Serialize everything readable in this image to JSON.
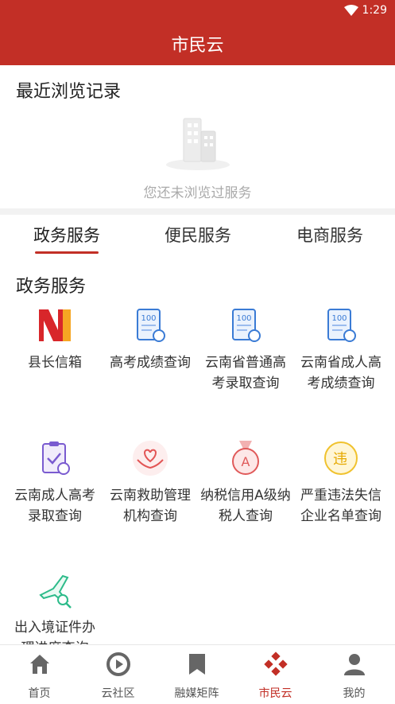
{
  "status_bar": {
    "time": "1:29"
  },
  "app_bar": {
    "title": "市民云"
  },
  "recent": {
    "title": "最近浏览记录",
    "empty_text": "您还未浏览过服务"
  },
  "tabs": [
    {
      "label": "政务服务",
      "active": true
    },
    {
      "label": "便民服务",
      "active": false
    },
    {
      "label": "电商服务",
      "active": false
    }
  ],
  "gov_section": {
    "title": "政务服务",
    "items": [
      {
        "label": "县长信箱",
        "icon": "county-mayor-mailbox-icon"
      },
      {
        "label": "高考成绩查询",
        "icon": "score-100-icon"
      },
      {
        "label": "云南省普通高考录取查询",
        "icon": "score-100-icon"
      },
      {
        "label": "云南省成人高考成绩查询",
        "icon": "score-100-icon"
      },
      {
        "label": "云南成人高考录取查询",
        "icon": "clipboard-check-icon"
      },
      {
        "label": "云南救助管理机构查询",
        "icon": "heart-hands-icon"
      },
      {
        "label": "纳税信用A级纳税人查询",
        "icon": "medal-a-icon"
      },
      {
        "label": "严重违法失信企业名单查询",
        "icon": "violation-badge-icon"
      },
      {
        "label": "出入境证件办理进度查询",
        "icon": "airplane-search-icon"
      }
    ]
  },
  "bottom_nav": [
    {
      "label": "首页",
      "icon": "home-icon",
      "active": false
    },
    {
      "label": "云社区",
      "icon": "cloud-community-icon",
      "active": false
    },
    {
      "label": "融媒矩阵",
      "icon": "bookmark-icon",
      "active": false
    },
    {
      "label": "市民云",
      "icon": "citizen-cloud-icon",
      "active": true
    },
    {
      "label": "我的",
      "icon": "person-icon",
      "active": false
    }
  ],
  "colors": {
    "primary": "#c22f26",
    "accent_blue": "#3a7bd5"
  }
}
